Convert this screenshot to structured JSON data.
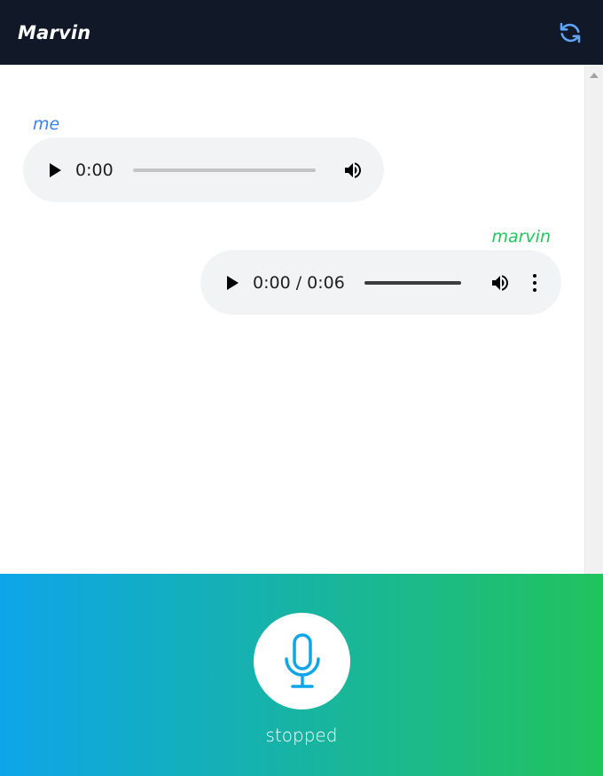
{
  "header": {
    "title": "Marvin",
    "refresh_icon": "refresh-icon",
    "background": "#111827",
    "icon_color": "#60a5fa"
  },
  "messages": [
    {
      "sender": "me",
      "sender_color": "#3b82f6",
      "audio": {
        "time": "0:00",
        "volume_icon": "volume-icon",
        "has_more_menu": false
      }
    },
    {
      "sender": "marvin",
      "sender_color": "#22c55e",
      "audio": {
        "time": "0:00 / 0:06",
        "volume_icon": "volume-icon",
        "has_more_menu": true,
        "more_icon": "more-vertical-icon"
      }
    }
  ],
  "footer": {
    "mic_icon": "microphone-icon",
    "status": "stopped",
    "gradient_start": "#0ea5e9",
    "gradient_end": "#21c35d",
    "mic_color": "#0ea5e9"
  }
}
